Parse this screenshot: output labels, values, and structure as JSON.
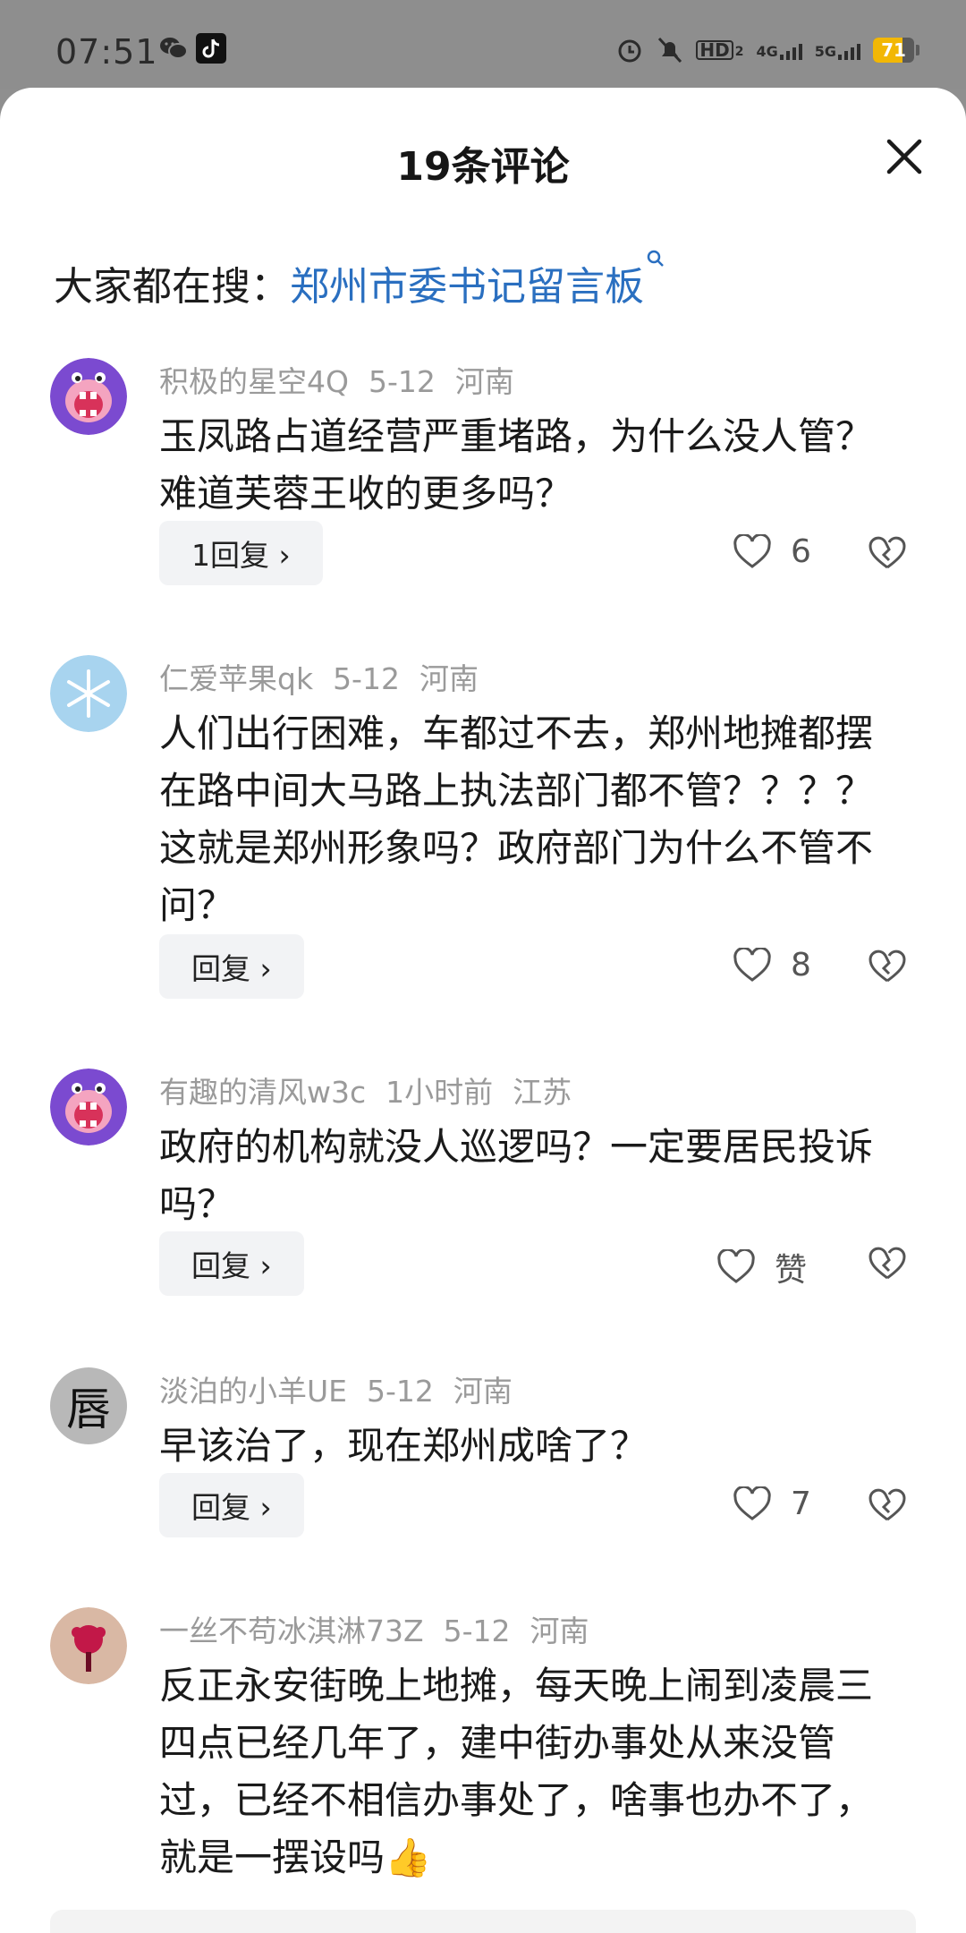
{
  "status_bar": {
    "time": "07:51",
    "hd": "HD",
    "hd_sub": "2",
    "net1": "4G",
    "net2": "5G",
    "battery_level": "71",
    "battery_fraction": 0.71,
    "battery_color": "#f2b705"
  },
  "header": {
    "title": "19条评论"
  },
  "search": {
    "prefix": "大家都在搜：",
    "query": "郑州市委书记留言板"
  },
  "comments": [
    {
      "user": "积极的星空4Q",
      "time": "5-12",
      "region": "河南",
      "text": "玉凤路占道经营严重堵路，为什么没人管？难道芙蓉王收的更多吗？",
      "reply": "1回复 ›",
      "likes": "6"
    },
    {
      "user": "仁爱苹果qk",
      "time": "5-12",
      "region": "河南",
      "text": "人们出行困难，车都过不去，郑州地摊都摆在路中间大马路上执法部门都不管？？？？这就是郑州形象吗？政府部门为什么不管不问？",
      "reply": "回复 ›",
      "likes": "8"
    },
    {
      "user": "有趣的清风w3c",
      "time": "1小时前",
      "region": "江苏",
      "text": "政府的机构就没人巡逻吗？一定要居民投诉吗？",
      "reply": "回复 ›",
      "likes": "赞"
    },
    {
      "user": "淡泊的小羊UE",
      "time": "5-12",
      "region": "河南",
      "text": "早该治了，现在郑州成啥了？",
      "reply": "回复 ›",
      "likes": "7"
    },
    {
      "user": "一丝不苟冰淇淋73Z",
      "time": "5-12",
      "region": "河南",
      "text": "反正永安街晚上地摊，每天晚上闹到凌晨三四点已经几年了，建中街办事处从来没管过，已经不相信办事处了，啥事也办不了，就是一摆设吗",
      "emoji": "👍"
    }
  ],
  "avatar_glyph": "唇"
}
